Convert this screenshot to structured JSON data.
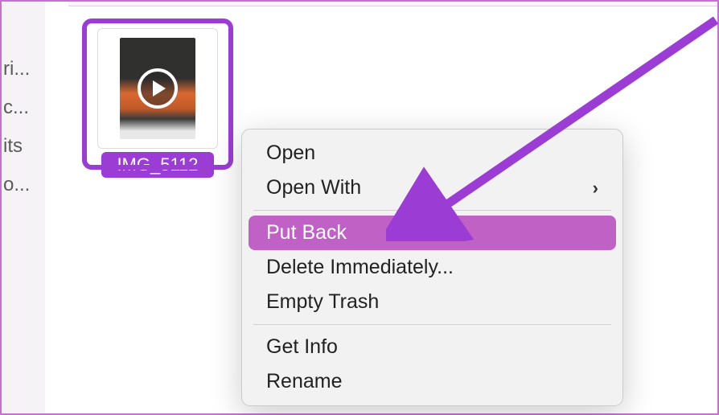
{
  "sidebar": {
    "items": [
      {
        "label": "ri..."
      },
      {
        "label": "c..."
      },
      {
        "label": "its"
      },
      {
        "label": "o..."
      }
    ]
  },
  "file": {
    "name": "IMG_5112"
  },
  "contextMenu": {
    "open": "Open",
    "openWith": "Open With",
    "putBack": "Put Back",
    "deleteImmediately": "Delete Immediately...",
    "emptyTrash": "Empty Trash",
    "getInfo": "Get Info",
    "rename": "Rename"
  },
  "annotation": {
    "color": "#9b3dd4"
  }
}
